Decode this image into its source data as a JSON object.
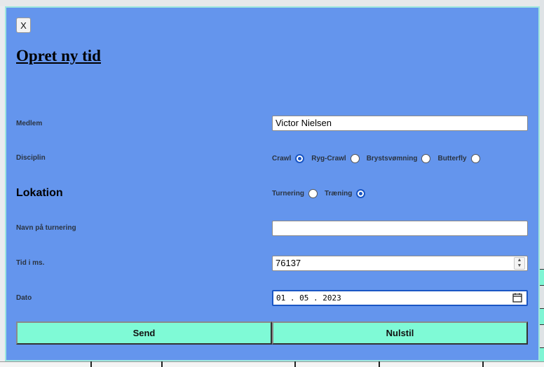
{
  "modal": {
    "close_label": "X",
    "title": "Opret ny tid"
  },
  "form": {
    "member": {
      "label": "Medlem",
      "value": "Victor Nielsen"
    },
    "discipline": {
      "label": "Disciplin",
      "options": [
        "Crawl",
        "Ryg-Crawl",
        "Brystsvømning",
        "Butterfly"
      ],
      "selected": "Crawl"
    },
    "location": {
      "label": "Lokation",
      "options": [
        "Turnering",
        "Træning"
      ],
      "selected": "Træning"
    },
    "tournament_name": {
      "label": "Navn på turnering",
      "value": ""
    },
    "time_ms": {
      "label": "Tid i ms.",
      "value": "76137"
    },
    "date": {
      "label": "Dato",
      "value": "01 . 05 . 2023"
    }
  },
  "buttons": {
    "send": "Send",
    "reset": "Nulstil"
  },
  "colors": {
    "modal_bg": "#6495ed",
    "button_bg": "#7ffad6",
    "focus": "#1a56c4"
  }
}
